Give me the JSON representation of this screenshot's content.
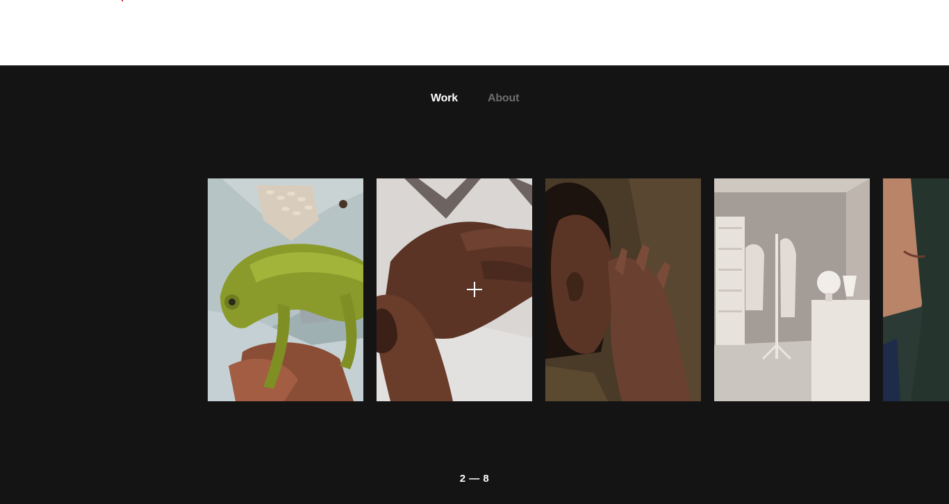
{
  "nav": {
    "work_label": "Work",
    "about_label": "About",
    "active": "Work"
  },
  "gallery": {
    "items": [
      {
        "name": "chameleon-on-hand"
      },
      {
        "name": "hands-on-surface"
      },
      {
        "name": "woman-touching-face"
      },
      {
        "name": "white-bedroom"
      },
      {
        "name": "profile-face"
      }
    ],
    "counter": {
      "current": "2",
      "separator": "—",
      "total": "8",
      "text": "2 — 8"
    }
  },
  "colors": {
    "background": "#141414",
    "nav_active": "#ffffff",
    "nav_inactive": "#6e6e6e"
  }
}
